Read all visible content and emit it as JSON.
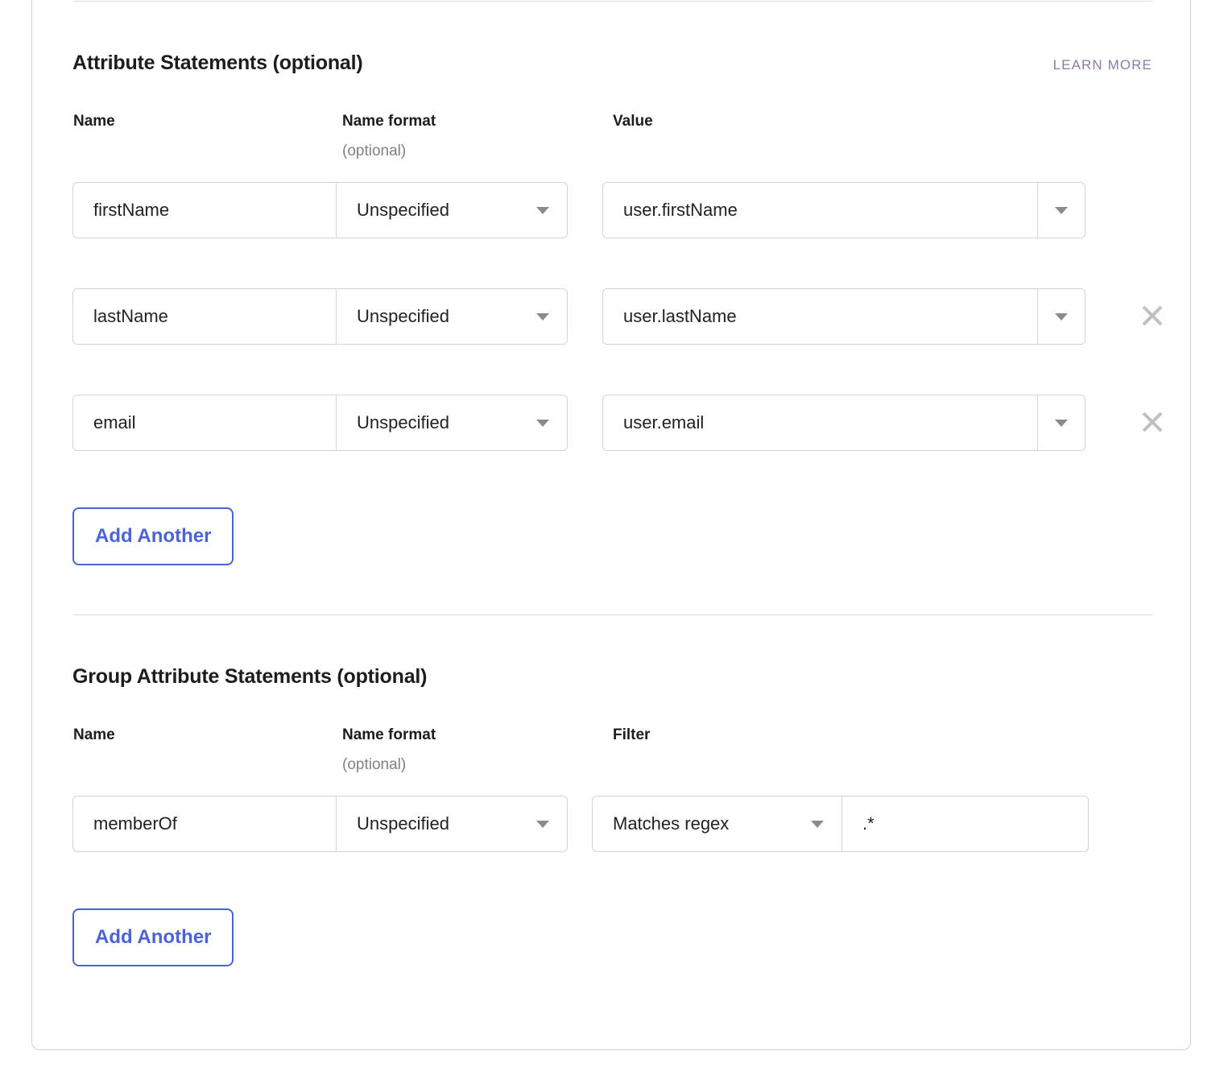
{
  "attribute_statements": {
    "title": "Attribute Statements (optional)",
    "learn_more": "LEARN MORE",
    "columns": {
      "name": "Name",
      "name_format": "Name format",
      "name_format_sub": "(optional)",
      "value": "Value"
    },
    "rows": [
      {
        "name": "firstName",
        "name_format": "Unspecified",
        "value": "user.firstName",
        "removable": false
      },
      {
        "name": "lastName",
        "name_format": "Unspecified",
        "value": "user.lastName",
        "removable": true
      },
      {
        "name": "email",
        "name_format": "Unspecified",
        "value": "user.email",
        "removable": true
      }
    ],
    "add_another": "Add Another"
  },
  "group_attribute_statements": {
    "title": "Group Attribute Statements (optional)",
    "columns": {
      "name": "Name",
      "name_format": "Name format",
      "name_format_sub": "(optional)",
      "filter": "Filter"
    },
    "rows": [
      {
        "name": "memberOf",
        "name_format": "Unspecified",
        "filter_type": "Matches regex",
        "filter_value": ".*"
      }
    ],
    "add_another": "Add Another"
  },
  "icons": {
    "caret_down": "chevron-down-icon",
    "remove": "close-icon"
  },
  "colors": {
    "accent_button": "#4a63d8",
    "learn_more_link": "#8f7aa5",
    "border": "#d4d4d8",
    "divider": "#dcdde1",
    "text_primary": "#1d1d21",
    "text_muted": "#7f7f87"
  }
}
